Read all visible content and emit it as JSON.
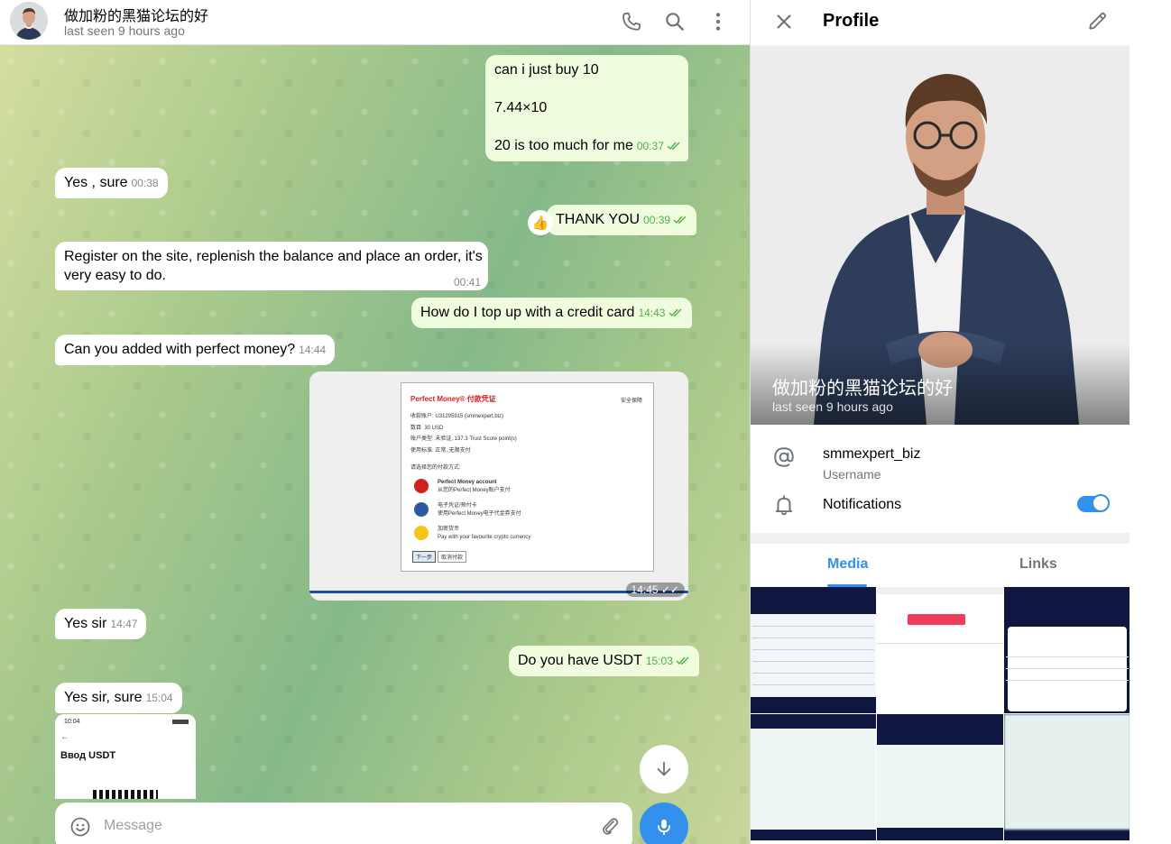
{
  "chat": {
    "title": "做加粉的黑猫论坛的好",
    "status": "last seen 9 hours ago",
    "composer_placeholder": "Message",
    "messages": {
      "m1": {
        "lines": [
          "can i just buy 10",
          "",
          "7.44×10",
          "",
          "20 is too much for me"
        ],
        "time": "00:37"
      },
      "m2": {
        "text": "Yes , sure",
        "time": "00:38"
      },
      "m3": {
        "text": "THANK YOU",
        "time": "00:39",
        "reaction": "👍"
      },
      "m4": {
        "lines": [
          "Register on the site, replenish the balance and place an order, it's",
          "very easy to do."
        ],
        "time": "00:41"
      },
      "m5": {
        "text": "How do I top up with a credit card",
        "time": "14:43"
      },
      "m6": {
        "text": "Can you added with perfect money?",
        "time": "14:44"
      },
      "m7": {
        "time": "14:45",
        "doc": {
          "brand": "Perfect Money® 付款凭证",
          "lock": "安全保障",
          "fields": [
            "收款账户:  U31295915 (smmexpert.biz)",
            "数目:  30 USD",
            "账户类型:  未验证, 137.3 Trust Score point(s)",
            "使用标准:  正常, 无限支付"
          ],
          "prompt": "请选择您的付款方式:",
          "options": [
            {
              "title": "Perfect Money account",
              "sub": "从您的Perfect Money账户支付"
            },
            {
              "title": "电子凭证/预付卡",
              "sub": "使用Perfect Money电子代金券支付"
            },
            {
              "title": "加密货币",
              "sub": "Pay with your favourite crypto currency"
            }
          ],
          "buttons": [
            "下一步",
            "取消付款"
          ]
        }
      },
      "m8": {
        "text": "Yes sir",
        "time": "14:47"
      },
      "m9": {
        "text": "Do you have USDT",
        "time": "15:03"
      },
      "m10": {
        "text": "Yes sir, sure",
        "time": "15:04"
      },
      "m11": {
        "status_time": "10:04",
        "title": "Ввод USDT"
      }
    }
  },
  "profile": {
    "title": "Profile",
    "name": "做加粉的黑猫论坛的好",
    "status": "last seen 9 hours ago",
    "username": "smmexpert_biz",
    "username_caption": "Username",
    "notifications_label": "Notifications",
    "notifications_on": true,
    "tabs": [
      "Media",
      "Links"
    ],
    "active_tab": "Media"
  },
  "colors": {
    "accent": "#3390ec",
    "out_bubble": "#effdde",
    "in_bubble": "#ffffff",
    "check": "#4fae4e"
  },
  "icons": [
    "phone-icon",
    "search-icon",
    "more-vertical-icon",
    "close-icon",
    "pencil-icon",
    "at-icon",
    "bell-icon",
    "emoji-icon",
    "paperclip-icon",
    "microphone-icon",
    "arrow-down-icon"
  ]
}
